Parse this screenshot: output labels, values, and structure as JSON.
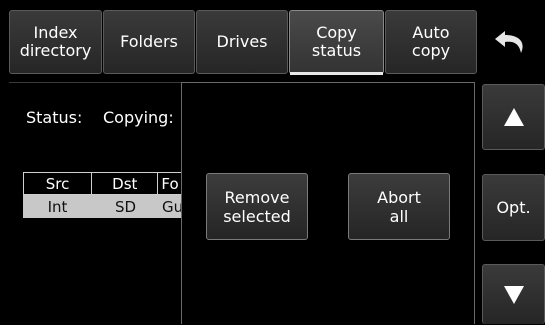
{
  "tabs": [
    {
      "label": "Index\ndirectory",
      "active": false
    },
    {
      "label": "Folders",
      "active": false
    },
    {
      "label": "Drives",
      "active": false
    },
    {
      "label": "Copy\nstatus",
      "active": true
    },
    {
      "label": "Auto\ncopy",
      "active": false
    }
  ],
  "status": {
    "label": "Status:",
    "value": "Copying:"
  },
  "table": {
    "headers": [
      "Src",
      "Dst",
      "Fo"
    ],
    "row": [
      "Int",
      "SD",
      "Gu"
    ]
  },
  "dialog": {
    "remove_label": "Remove\nselected",
    "abort_label": "Abort\nall"
  },
  "side": {
    "options_label": "Opt."
  },
  "icons": {
    "back": "undo-arrow-icon",
    "up": "triangle-up-icon",
    "down": "triangle-down-icon"
  }
}
